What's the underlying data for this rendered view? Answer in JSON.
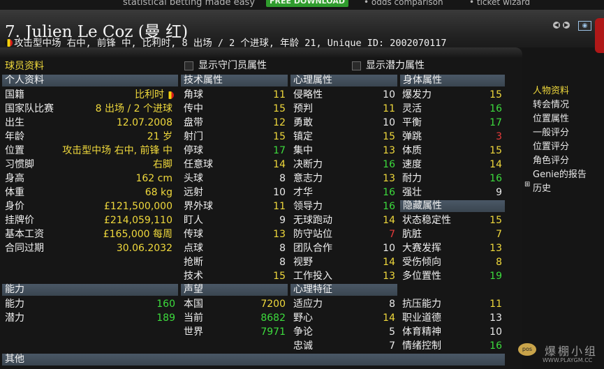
{
  "ad": {
    "text1": "statistical betting made easy",
    "button": "FREE DOWNLOAD",
    "text2": "• odds comparison",
    "text3": "• ticket wizard"
  },
  "header": {
    "title": "7. Julien Le Coz (曼 红)",
    "subtitle": "攻击型中场 右中, 前锋 中, 比利时, 8 出场 / 2 个进球, 年龄 21, Unique ID: 2002070117",
    "icon_prev": "back-icon",
    "icon_next": "forward-icon",
    "icon_camera": "camera-icon"
  },
  "panel": {
    "title": "球员资料",
    "checkbox_gk": "显示守门员属性",
    "checkbox_potential": "显示潜力属性"
  },
  "personal": {
    "header": "个人资料",
    "rows": [
      {
        "label": "国籍",
        "value": "比利时"
      },
      {
        "label": "国家队比赛",
        "value": "8 出场 / 2 个进球"
      },
      {
        "label": "出生",
        "value": "12.07.2008"
      },
      {
        "label": "年龄",
        "value": "21 岁"
      },
      {
        "label": "位置",
        "value": "攻击型中场 右中, 前锋 中"
      },
      {
        "label": "习惯脚",
        "value": "右脚"
      },
      {
        "label": "身高",
        "value": "162 cm"
      },
      {
        "label": "体重",
        "value": "68 kg"
      },
      {
        "label": "身价",
        "value": "£121,500,000"
      },
      {
        "label": "挂牌价",
        "value": "£214,059,110"
      },
      {
        "label": "基本工资",
        "value": "£165,000 每周"
      },
      {
        "label": "合同过期",
        "value": "30.06.2032"
      }
    ]
  },
  "ability": {
    "header": "能力",
    "rows": [
      {
        "label": "能力",
        "value": "160"
      },
      {
        "label": "潜力",
        "value": "189"
      }
    ]
  },
  "other": {
    "header": "其他"
  },
  "technical": {
    "header": "技术属性",
    "rows": [
      {
        "label": "角球",
        "value": "11"
      },
      {
        "label": "传中",
        "value": "15"
      },
      {
        "label": "盘带",
        "value": "12"
      },
      {
        "label": "射门",
        "value": "15"
      },
      {
        "label": "停球",
        "value": "17"
      },
      {
        "label": "任意球",
        "value": "14"
      },
      {
        "label": "头球",
        "value": "8"
      },
      {
        "label": "远射",
        "value": "10"
      },
      {
        "label": "界外球",
        "value": "11"
      },
      {
        "label": "盯人",
        "value": "9"
      },
      {
        "label": "传球",
        "value": "13"
      },
      {
        "label": "点球",
        "value": "8"
      },
      {
        "label": "抢断",
        "value": "8"
      },
      {
        "label": "技术",
        "value": "15"
      }
    ]
  },
  "reputation": {
    "header": "声望",
    "rows": [
      {
        "label": "本国",
        "value": "7200"
      },
      {
        "label": "当前",
        "value": "8682"
      },
      {
        "label": "世界",
        "value": "7971"
      }
    ]
  },
  "mental": {
    "header": "心理属性",
    "rows": [
      {
        "label": "侵略性",
        "value": "10"
      },
      {
        "label": "预判",
        "value": "11"
      },
      {
        "label": "勇敢",
        "value": "10"
      },
      {
        "label": "镇定",
        "value": "15"
      },
      {
        "label": "集中",
        "value": "13"
      },
      {
        "label": "决断力",
        "value": "16"
      },
      {
        "label": "意志力",
        "value": "13"
      },
      {
        "label": "才华",
        "value": "16"
      },
      {
        "label": "领导力",
        "value": "16"
      },
      {
        "label": "无球跑动",
        "value": "14"
      },
      {
        "label": "防守站位",
        "value": "7"
      },
      {
        "label": "团队合作",
        "value": "10"
      },
      {
        "label": "视野",
        "value": "14"
      },
      {
        "label": "工作投入",
        "value": "13"
      }
    ]
  },
  "traits": {
    "header": "心理特征",
    "rows": [
      {
        "label": "适应力",
        "value": "8"
      },
      {
        "label": "野心",
        "value": "14"
      },
      {
        "label": "争论",
        "value": "5"
      },
      {
        "label": "忠诚",
        "value": "7"
      }
    ]
  },
  "physical": {
    "header": "身体属性",
    "rows": [
      {
        "label": "爆发力",
        "value": "15"
      },
      {
        "label": "灵活",
        "value": "16"
      },
      {
        "label": "平衡",
        "value": "17"
      },
      {
        "label": "弹跳",
        "value": "3"
      },
      {
        "label": "体质",
        "value": "15"
      },
      {
        "label": "速度",
        "value": "14"
      },
      {
        "label": "耐力",
        "value": "16"
      },
      {
        "label": "强壮",
        "value": "9"
      }
    ]
  },
  "hidden": {
    "header": "隐藏属性",
    "rows": [
      {
        "label": "状态稳定性",
        "value": "15"
      },
      {
        "label": "肮脏",
        "value": "7"
      },
      {
        "label": "大赛发挥",
        "value": "13"
      },
      {
        "label": "受伤倾向",
        "value": "8"
      },
      {
        "label": "多位置性",
        "value": "19"
      },
      {
        "label": "抗压能力",
        "value": "11"
      },
      {
        "label": "职业道德",
        "value": "13"
      },
      {
        "label": "体育精神",
        "value": "10"
      },
      {
        "label": "情绪控制",
        "value": "16"
      }
    ]
  },
  "sidebar": {
    "items": [
      {
        "label": "人物资料"
      },
      {
        "label": "转会情况"
      },
      {
        "label": "位置属性"
      },
      {
        "label": "一般评分"
      },
      {
        "label": "位置评分"
      },
      {
        "label": "角色评分"
      },
      {
        "label": "Genie的报告"
      },
      {
        "label": "历史"
      }
    ],
    "history_expand_icon": "expand-plus-icon"
  },
  "watermark": {
    "name": "爆棚小组",
    "url": "WWW.PLAYGM.CC",
    "logo": "pos"
  },
  "colors": {
    "highlight": "#f0d93c",
    "good": "#3ddc3d",
    "bad": "#e83a3a",
    "section_bar": "#45515c"
  }
}
